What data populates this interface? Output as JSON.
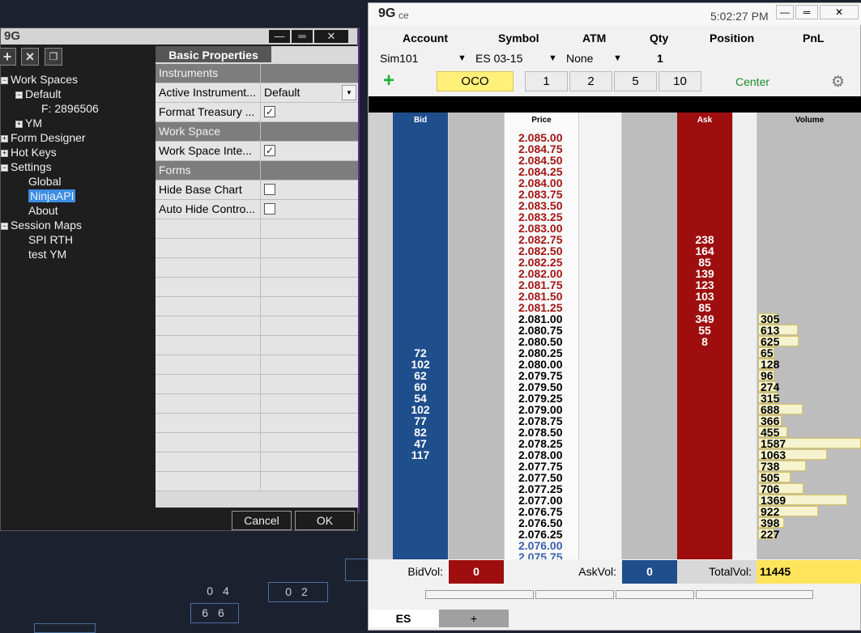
{
  "workspace": {
    "logo": "9G",
    "window_buttons": [
      "—",
      "═",
      "✕"
    ],
    "tree": [
      {
        "label": "Work Spaces",
        "exp": "−"
      },
      {
        "label": "Default",
        "exp": "−"
      },
      {
        "label": "F: 2896506",
        "exp": ""
      },
      {
        "label": "YM",
        "exp": "+"
      },
      {
        "label": "Form Designer",
        "exp": "+"
      },
      {
        "label": "Hot Keys",
        "exp": "+"
      },
      {
        "label": "Settings",
        "exp": "−"
      },
      {
        "label": "Global",
        "exp": ""
      },
      {
        "label": "NinjaAPI",
        "exp": ""
      },
      {
        "label": "About",
        "exp": ""
      },
      {
        "label": "Session Maps",
        "exp": "−"
      },
      {
        "label": "SPI RTH",
        "exp": ""
      },
      {
        "label": "test YM",
        "exp": ""
      }
    ],
    "props_tab": "Basic Properties",
    "rows": [
      {
        "k": "Instruments",
        "v": "",
        "cat": true
      },
      {
        "k": "Active Instrument...",
        "v": "Default",
        "dd": true
      },
      {
        "k": "Format Treasury ...",
        "v": "",
        "chk": "✓"
      },
      {
        "k": "Work Space",
        "v": "",
        "cat": true
      },
      {
        "k": "Work Space Inte...",
        "v": "",
        "chk": "✓"
      },
      {
        "k": "Forms",
        "v": "",
        "cat": true
      },
      {
        "k": "Hide Base Chart",
        "v": "",
        "chk": " "
      },
      {
        "k": "Auto Hide Contro...",
        "v": "",
        "chk": " "
      }
    ],
    "cancel": "Cancel",
    "ok": "OK"
  },
  "dom": {
    "logo": "9G",
    "logo_suffix": "ce",
    "time": "5:02:27 PM",
    "window_buttons": [
      "—",
      "═",
      "✕"
    ],
    "headers": [
      "Account",
      "Symbol",
      "ATM",
      "Qty",
      "Position",
      "PnL"
    ],
    "account": "Sim101",
    "symbol": "ES 03-15",
    "atm": "None",
    "qty": "1",
    "plus_icon": "+",
    "oco": "OCO",
    "qty_buttons": [
      "1",
      "2",
      "5",
      "10"
    ],
    "center": "Center",
    "col_headers": {
      "bid": "Bid",
      "price": "Price",
      "ask": "Ask",
      "volume": "Volume"
    },
    "ladder": [
      {
        "p": "2.085.00",
        "pc": "r",
        "ask": "",
        "bid": "",
        "vol": ""
      },
      {
        "p": "2.084.75",
        "pc": "r",
        "ask": "",
        "bid": "",
        "vol": ""
      },
      {
        "p": "2.084.50",
        "pc": "r",
        "ask": "",
        "bid": "",
        "vol": ""
      },
      {
        "p": "2.084.25",
        "pc": "r",
        "ask": "",
        "bid": "",
        "vol": ""
      },
      {
        "p": "2.084.00",
        "pc": "r",
        "ask": "",
        "bid": "",
        "vol": ""
      },
      {
        "p": "2.083.75",
        "pc": "r",
        "ask": "",
        "bid": "",
        "vol": ""
      },
      {
        "p": "2.083.50",
        "pc": "r",
        "ask": "",
        "bid": "",
        "vol": ""
      },
      {
        "p": "2.083.25",
        "pc": "r",
        "ask": "",
        "bid": "",
        "vol": ""
      },
      {
        "p": "2.083.00",
        "pc": "r",
        "ask": "",
        "bid": "",
        "vol": ""
      },
      {
        "p": "2.082.75",
        "pc": "r",
        "ask": "238",
        "bid": "",
        "vol": ""
      },
      {
        "p": "2.082.50",
        "pc": "r",
        "ask": "164",
        "bid": "",
        "vol": ""
      },
      {
        "p": "2.082.25",
        "pc": "r",
        "ask": "85",
        "bid": "",
        "vol": ""
      },
      {
        "p": "2.082.00",
        "pc": "r",
        "ask": "139",
        "bid": "",
        "vol": ""
      },
      {
        "p": "2.081.75",
        "pc": "r",
        "ask": "123",
        "bid": "",
        "vol": ""
      },
      {
        "p": "2.081.50",
        "pc": "r",
        "ask": "103",
        "bid": "",
        "vol": ""
      },
      {
        "p": "2.081.25",
        "pc": "r",
        "ask": "85",
        "bid": "",
        "vol": ""
      },
      {
        "p": "2.081.00",
        "pc": "k",
        "ask": "349",
        "bid": "",
        "vol": "305"
      },
      {
        "p": "2.080.75",
        "pc": "k",
        "ask": "55",
        "bid": "",
        "vol": "613"
      },
      {
        "p": "2.080.50",
        "pc": "k",
        "ask": "8",
        "bid": "",
        "vol": "625"
      },
      {
        "p": "2.080.25",
        "pc": "k",
        "ask": "",
        "bid": "72",
        "vol": "65"
      },
      {
        "p": "2.080.00",
        "pc": "k",
        "ask": "",
        "bid": "102",
        "vol": "128"
      },
      {
        "p": "2.079.75",
        "pc": "k",
        "ask": "",
        "bid": "62",
        "vol": "96"
      },
      {
        "p": "2.079.50",
        "pc": "k",
        "ask": "",
        "bid": "60",
        "vol": "274"
      },
      {
        "p": "2.079.25",
        "pc": "k",
        "ask": "",
        "bid": "54",
        "vol": "315"
      },
      {
        "p": "2.079.00",
        "pc": "k",
        "ask": "",
        "bid": "102",
        "vol": "688"
      },
      {
        "p": "2.078.75",
        "pc": "k",
        "ask": "",
        "bid": "77",
        "vol": "366"
      },
      {
        "p": "2.078.50",
        "pc": "k",
        "ask": "",
        "bid": "82",
        "vol": "455"
      },
      {
        "p": "2.078.25",
        "pc": "k",
        "ask": "",
        "bid": "47",
        "vol": "1587"
      },
      {
        "p": "2.078.00",
        "pc": "k",
        "ask": "",
        "bid": "117",
        "vol": "1063"
      },
      {
        "p": "2.077.75",
        "pc": "k",
        "ask": "",
        "bid": "",
        "vol": "738"
      },
      {
        "p": "2.077.50",
        "pc": "k",
        "ask": "",
        "bid": "",
        "vol": "505"
      },
      {
        "p": "2.077.25",
        "pc": "k",
        "ask": "",
        "bid": "",
        "vol": "706"
      },
      {
        "p": "2.077.00",
        "pc": "k",
        "ask": "",
        "bid": "",
        "vol": "1369"
      },
      {
        "p": "2.076.75",
        "pc": "k",
        "ask": "",
        "bid": "",
        "vol": "922"
      },
      {
        "p": "2.076.50",
        "pc": "k",
        "ask": "",
        "bid": "",
        "vol": "398"
      },
      {
        "p": "2.076.25",
        "pc": "k",
        "ask": "",
        "bid": "",
        "vol": "227"
      },
      {
        "p": "2.076.00",
        "pc": "b",
        "ask": "",
        "bid": "",
        "vol": ""
      },
      {
        "p": "2.075.75",
        "pc": "b",
        "ask": "",
        "bid": "",
        "vol": ""
      }
    ],
    "bidvol_label": "BidVol:",
    "bidvol": "0",
    "askvol_label": "AskVol:",
    "askvol": "0",
    "totalvol_label": "TotalVol:",
    "totalvol": "11445",
    "tab": "ES",
    "tab_add": "+"
  },
  "bg_cells": [
    "0 4",
    "0 2",
    "6 6"
  ],
  "colors": {
    "bid": "#1f4e8c",
    "ask": "#9e0e0e",
    "price_up": "#a31515",
    "price_down": "#3a5fb0",
    "vol_bar": "#f5f3d0",
    "total": "#ffe45c"
  }
}
